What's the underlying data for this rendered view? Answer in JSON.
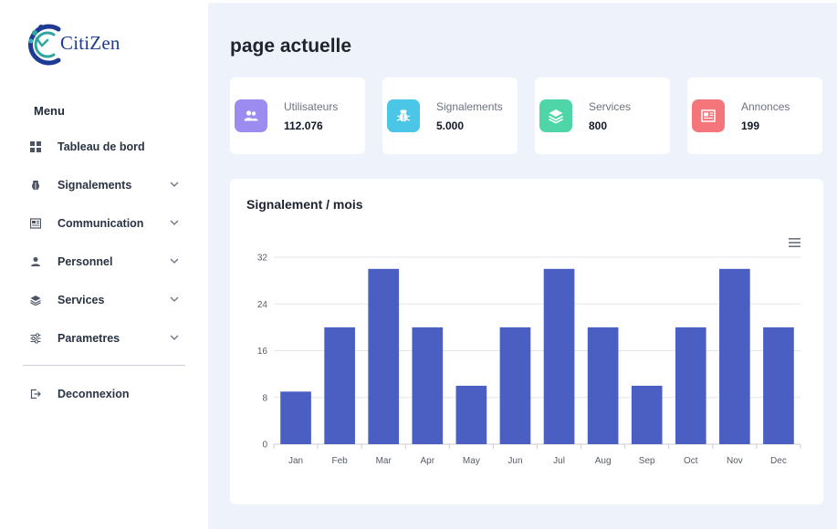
{
  "app": {
    "logo_text": "CitiZen",
    "accent_color": "#4a5fc1"
  },
  "sidebar": {
    "menu_title": "Menu",
    "items": [
      {
        "label": "Tableau de bord",
        "icon": "grid-icon",
        "has_chevron": false
      },
      {
        "label": "Signalements",
        "icon": "bug-icon",
        "has_chevron": true
      },
      {
        "label": "Communication",
        "icon": "newspaper-icon",
        "has_chevron": true
      },
      {
        "label": "Personnel",
        "icon": "user-icon",
        "has_chevron": true
      },
      {
        "label": "Services",
        "icon": "layers-icon",
        "has_chevron": true
      },
      {
        "label": "Parametres",
        "icon": "sliders-icon",
        "has_chevron": true
      }
    ],
    "logout_label": "Deconnexion"
  },
  "main": {
    "page_title": "page actuelle",
    "stats": [
      {
        "label": "Utilisateurs",
        "value": "112.076",
        "color": "#9c8cf0",
        "icon": "users-icon"
      },
      {
        "label": "Signalements",
        "value": "5.000",
        "color": "#4cc6e6",
        "icon": "bug-icon"
      },
      {
        "label": "Services",
        "value": "800",
        "color": "#4fd6a8",
        "icon": "layers-icon"
      },
      {
        "label": "Annonces",
        "value": "199",
        "color": "#f5767a",
        "icon": "newspaper-icon"
      }
    ],
    "chart_title": "Signalement / mois"
  },
  "chart_data": {
    "type": "bar",
    "title": "Signalement / mois",
    "categories": [
      "Jan",
      "Feb",
      "Mar",
      "Apr",
      "May",
      "Jun",
      "Jul",
      "Aug",
      "Sep",
      "Oct",
      "Nov",
      "Dec"
    ],
    "values": [
      9,
      20,
      30,
      20,
      10,
      20,
      30,
      20,
      10,
      20,
      30,
      20
    ],
    "y_ticks": [
      "0",
      "8",
      "16",
      "24",
      "32"
    ],
    "ylim": [
      0,
      32
    ],
    "grid": true,
    "bar_color": "#4a5fc1"
  }
}
